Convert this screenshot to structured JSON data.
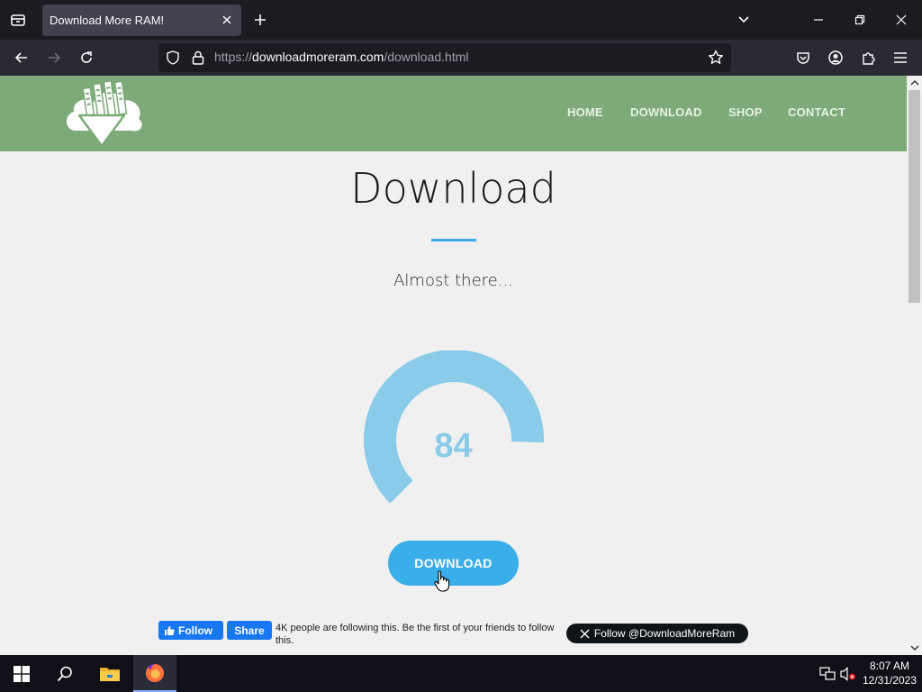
{
  "browser": {
    "tab_title": "Download More RAM!",
    "url_prefix": "https://",
    "url_domain": "downloadmoreram.com",
    "url_path": "/download.html"
  },
  "site": {
    "header_color": "#7daa78",
    "nav": [
      "HOME",
      "DOWNLOAD",
      "SHOP",
      "CONTACT"
    ]
  },
  "main": {
    "title": "Download",
    "subtitle": "Almost there...",
    "progress_value": "84",
    "progress_percent": 84,
    "download_label": "DOWNLOAD",
    "accent_color": "#3aaee8"
  },
  "social": {
    "fb_follow_label": "Follow",
    "fb_share_label": "Share",
    "fb_text": "4K people are following this. Be the first of your friends to follow this.",
    "x_follow_label": "Follow @DownloadMoreRam"
  },
  "taskbar": {
    "time": "8:07 AM",
    "date": "12/31/2023"
  }
}
